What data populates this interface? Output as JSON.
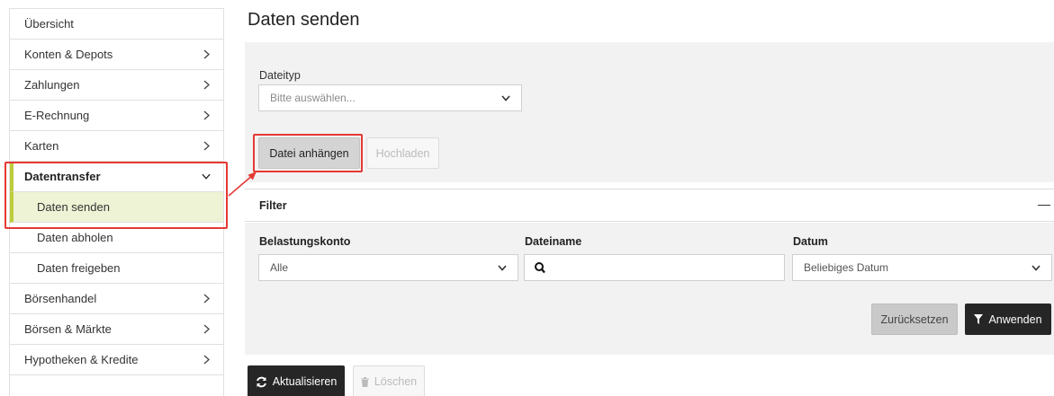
{
  "sidebar": {
    "items": [
      {
        "label": "Übersicht"
      },
      {
        "label": "Konten & Depots"
      },
      {
        "label": "Zahlungen"
      },
      {
        "label": "E-Rechnung"
      },
      {
        "label": "Karten"
      },
      {
        "label": "Datentransfer"
      },
      {
        "label": "Daten senden"
      },
      {
        "label": "Daten abholen"
      },
      {
        "label": "Daten freigeben"
      },
      {
        "label": "Börsenhandel"
      },
      {
        "label": "Börsen & Märkte"
      },
      {
        "label": "Hypotheken & Kredite"
      }
    ]
  },
  "page": {
    "title": "Daten senden"
  },
  "upload": {
    "file_type_label": "Dateityp",
    "file_type_placeholder": "Bitte auswählen...",
    "attach_button": "Datei anhängen",
    "upload_button": "Hochladen"
  },
  "filter": {
    "heading": "Filter",
    "account_label": "Belastungskonto",
    "account_value": "Alle",
    "filename_label": "Dateiname",
    "filename_value": "",
    "date_label": "Datum",
    "date_value": "Beliebiges Datum",
    "reset_button": "Zurücksetzen",
    "apply_button": "Anwenden"
  },
  "actions": {
    "refresh_button": "Aktualisieren",
    "delete_button": "Löschen"
  },
  "colors": {
    "accent": "#bccc3b",
    "active_bg": "#eef3d5",
    "annotation": "#e53935",
    "dark_button": "#262626"
  }
}
